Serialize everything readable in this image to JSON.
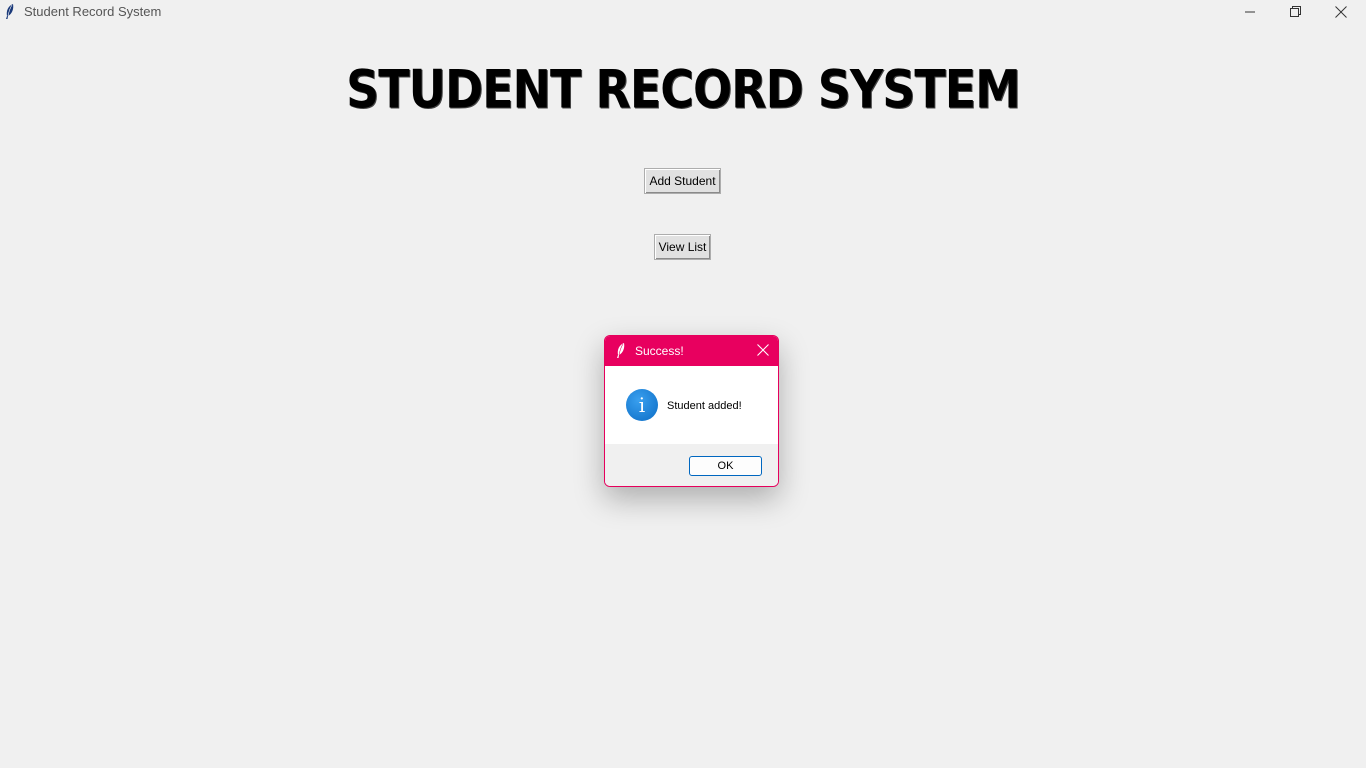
{
  "window": {
    "title": "Student Record System",
    "icon": "feather-icon",
    "controls": [
      "minimize-icon",
      "maximize-icon",
      "close-icon"
    ]
  },
  "main": {
    "heading": "STUDENT RECORD SYSTEM",
    "add_button": "Add Student",
    "view_button": "View List"
  },
  "dialog": {
    "title": "Success!",
    "icon": "info-icon",
    "message": "Student added!",
    "ok_button": "OK",
    "accent": "#e8005f"
  }
}
